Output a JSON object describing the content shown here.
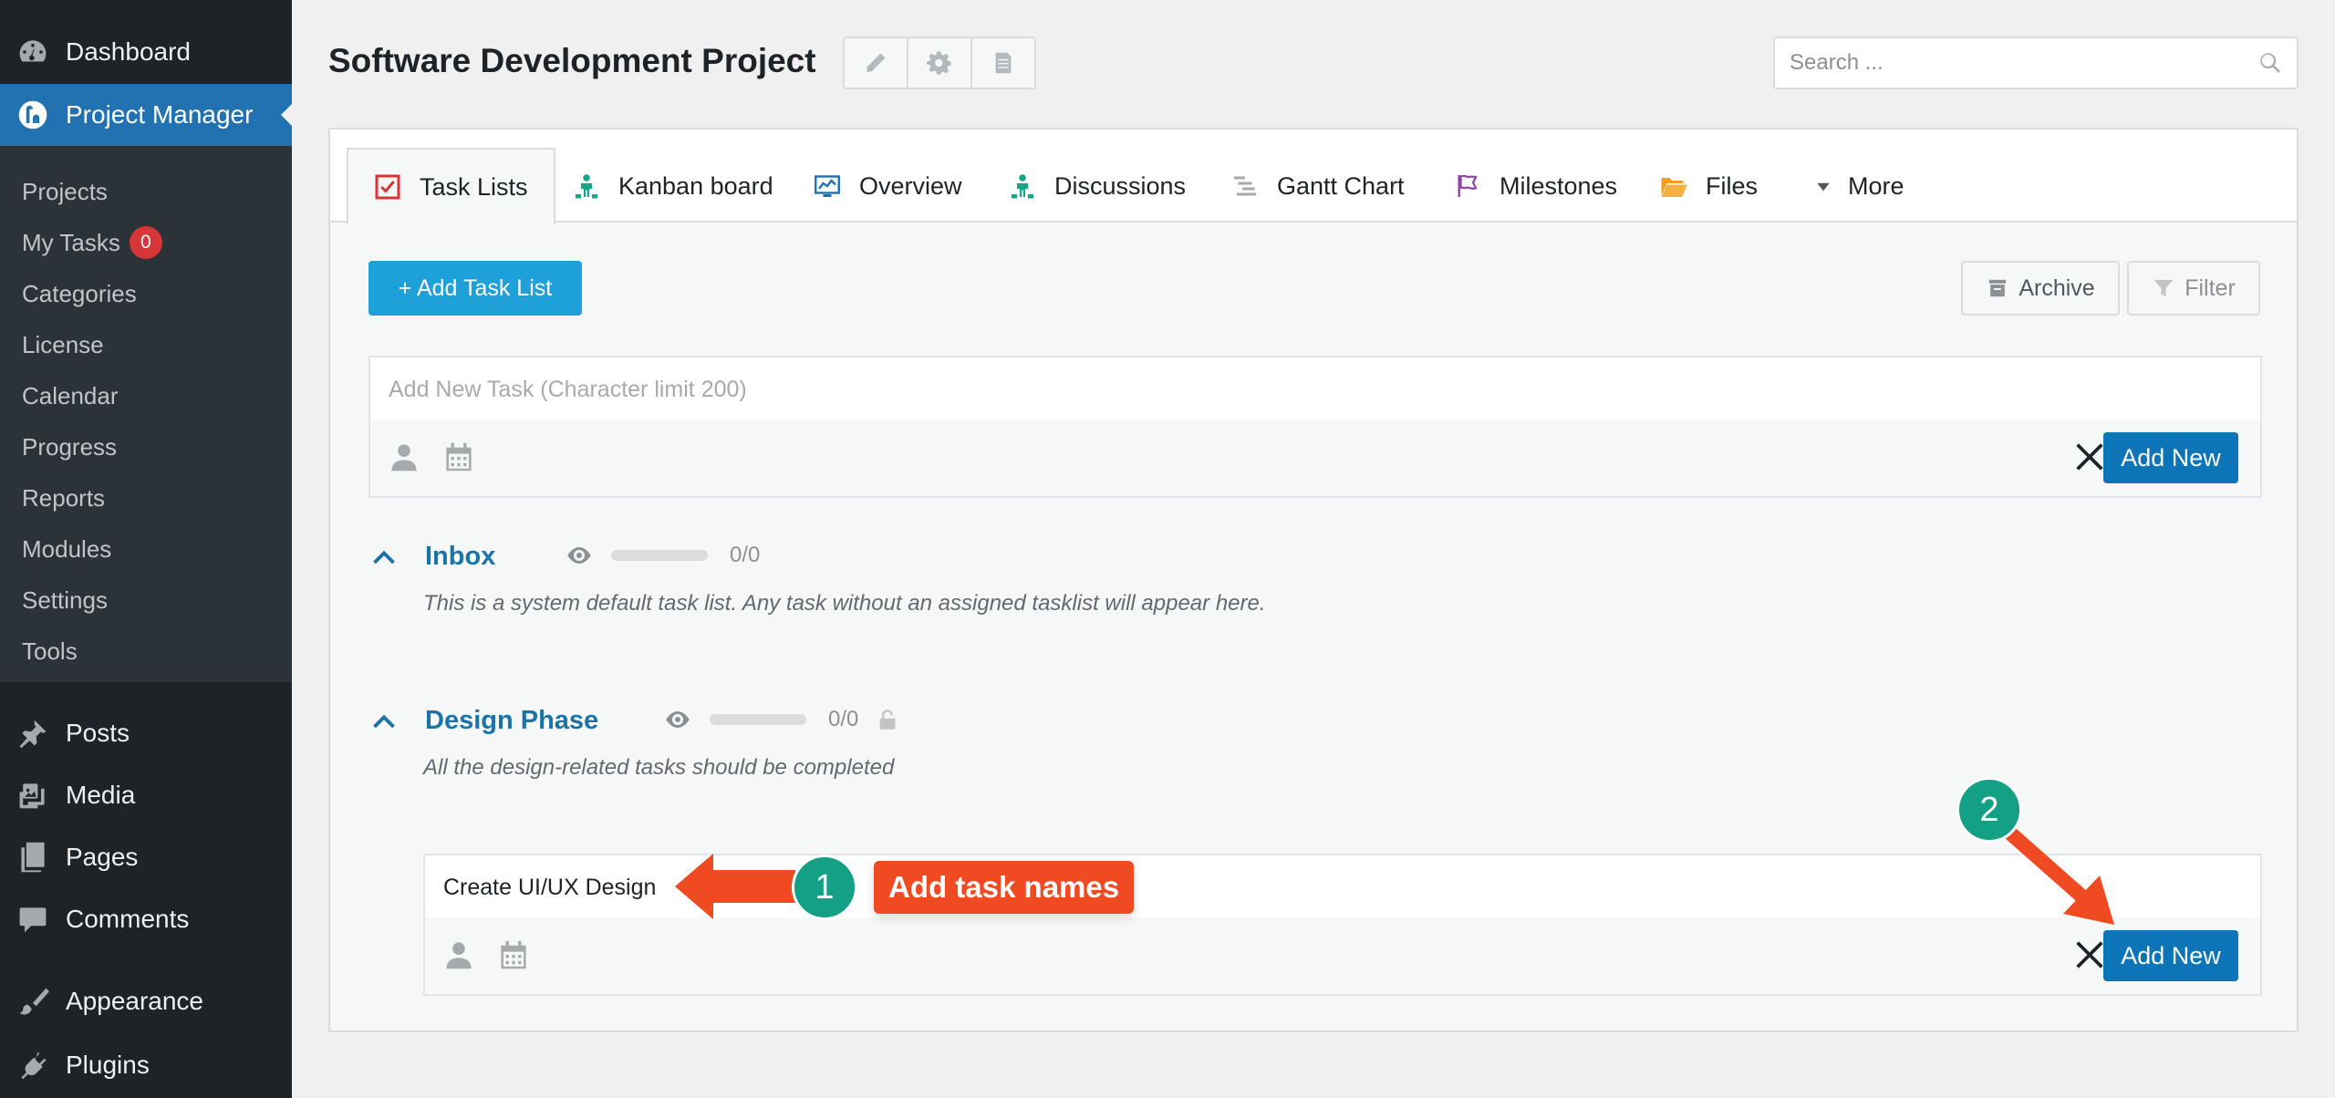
{
  "sidebar": {
    "top_items": [
      {
        "label": "Dashboard",
        "icon": "dashboard-icon"
      },
      {
        "label": "Project Manager",
        "icon": "project-manager-icon",
        "current": true
      }
    ],
    "submenu": [
      {
        "label": "Projects"
      },
      {
        "label": "My Tasks",
        "badge": "0"
      },
      {
        "label": "Categories"
      },
      {
        "label": "License"
      },
      {
        "label": "Calendar"
      },
      {
        "label": "Progress"
      },
      {
        "label": "Reports"
      },
      {
        "label": "Modules"
      },
      {
        "label": "Settings"
      },
      {
        "label": "Tools"
      }
    ],
    "bottom_items": [
      {
        "label": "Posts",
        "icon": "pin-icon"
      },
      {
        "label": "Media",
        "icon": "media-icon"
      },
      {
        "label": "Pages",
        "icon": "pages-icon"
      },
      {
        "label": "Comments",
        "icon": "comment-icon"
      },
      {
        "label": "Appearance",
        "icon": "brush-icon"
      },
      {
        "label": "Plugins",
        "icon": "plug-icon"
      }
    ]
  },
  "header": {
    "title": "Software Development Project",
    "tools": [
      "pencil-icon",
      "gear-icon",
      "document-icon"
    ],
    "search_placeholder": "Search ..."
  },
  "tabs": [
    {
      "label": "Task Lists",
      "icon": "checkbox-icon",
      "active": true
    },
    {
      "label": "Kanban board",
      "icon": "kanban-icon"
    },
    {
      "label": "Overview",
      "icon": "overview-icon"
    },
    {
      "label": "Discussions",
      "icon": "discussion-icon"
    },
    {
      "label": "Gantt Chart",
      "icon": "gantt-icon"
    },
    {
      "label": "Milestones",
      "icon": "flag-icon"
    },
    {
      "label": "Files",
      "icon": "folder-icon"
    },
    {
      "label": "More",
      "icon": "triangle-down-icon"
    }
  ],
  "toolbar": {
    "add_task_list": "+ Add Task List",
    "archive": "Archive",
    "filter": "Filter"
  },
  "new_task_form": {
    "placeholder": "Add New Task (Character limit 200)",
    "add_label": "Add New"
  },
  "lists": [
    {
      "title": "Inbox",
      "progress_text": "0/0",
      "progress_fraction": 0,
      "description": "This is a system default task list. Any task without an assigned tasklist will appear here."
    },
    {
      "title": "Design Phase",
      "progress_text": "0/0",
      "progress_fraction": 0,
      "description": "All the design-related tasks should be completed"
    }
  ],
  "design_task_form": {
    "value": "Create UI/UX Design",
    "add_label": "Add New"
  },
  "annotations": {
    "step1": "1",
    "step1_label": "Add task names",
    "step2": "2"
  },
  "colors": {
    "accent": "#2271b1",
    "primary_button": "#1ea0d8",
    "add_button": "#0d74b8",
    "annotation_arrow": "#f04a23",
    "step_badge": "#14a085"
  }
}
